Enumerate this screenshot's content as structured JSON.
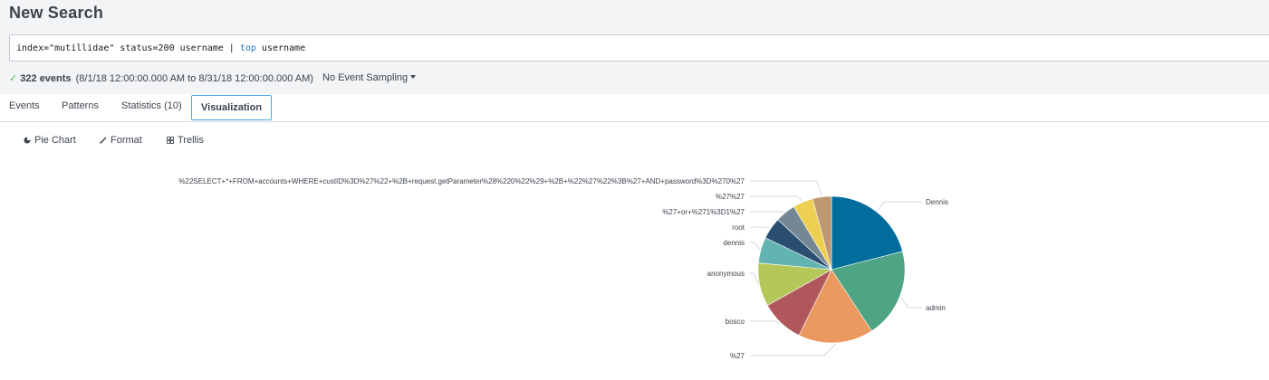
{
  "header": {
    "title": "New Search"
  },
  "search": {
    "query_part1": "index=\"mutillidae\" status=200 username | ",
    "query_keyword": "top",
    "query_part2": " username"
  },
  "status": {
    "check_icon": "✓",
    "events": "322 events",
    "range": "(8/1/18 12:00:00.000 AM to 8/31/18 12:00:00.000 AM)",
    "sampling": "No Event Sampling"
  },
  "tabs": [
    {
      "label": "Events"
    },
    {
      "label": "Patterns"
    },
    {
      "label": "Statistics (10)"
    },
    {
      "label": "Visualization"
    }
  ],
  "toolbar": {
    "pie_chart": "Pie Chart",
    "format": "Format",
    "trellis": "Trellis",
    "pie_icon": "pie-icon",
    "format_icon": "brush-icon",
    "trellis_icon": "grid-icon"
  },
  "chart_data": {
    "type": "pie",
    "slices": [
      {
        "label": "Dennis",
        "value": 66,
        "color": "#006d9c"
      },
      {
        "label": "admin",
        "value": 62,
        "color": "#4fa484"
      },
      {
        "label": "%27",
        "value": 52,
        "color": "#ec9960"
      },
      {
        "label": "bosco",
        "value": 30,
        "color": "#af575a"
      },
      {
        "label": "anonymous",
        "value": 30,
        "color": "#b6c75a"
      },
      {
        "label": "dennis",
        "value": 18,
        "color": "#62b3b2"
      },
      {
        "label": "root",
        "value": 15,
        "color": "#294e70"
      },
      {
        "label": "%27+or+%271%3D1%27",
        "value": 14,
        "color": "#738795"
      },
      {
        "label": "%27%27",
        "value": 14,
        "color": "#edd051"
      },
      {
        "label": "%22SELECT+*+FROM+accounts+WHERE+custID%3D%27%22+%2B+request.getParameter%28%220%22%29+%2B+%22%27%22%3B%27+AND+password%3D%270%27",
        "value": 13,
        "color": "#bd9872"
      }
    ]
  }
}
